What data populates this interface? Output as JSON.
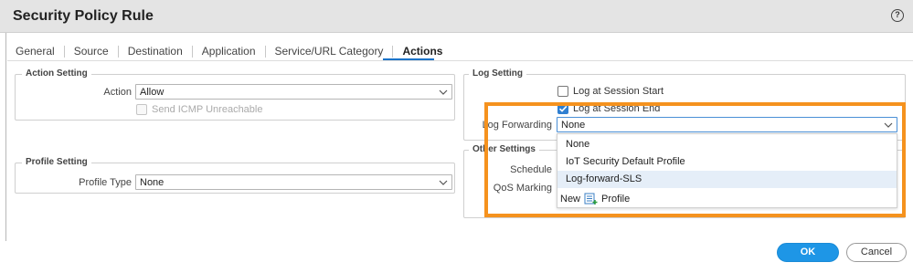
{
  "dialog": {
    "title": "Security Policy Rule",
    "help_glyph": "?"
  },
  "tabs": [
    {
      "label": "General"
    },
    {
      "label": "Source"
    },
    {
      "label": "Destination"
    },
    {
      "label": "Application"
    },
    {
      "label": "Service/URL Category"
    },
    {
      "label": "Actions"
    }
  ],
  "active_tab": "Actions",
  "action_setting": {
    "legend": "Action Setting",
    "action_label": "Action",
    "action_value": "Allow",
    "icmp_label": "Send ICMP Unreachable",
    "icmp_checked": false,
    "icmp_disabled": true
  },
  "profile_setting": {
    "legend": "Profile Setting",
    "profile_type_label": "Profile Type",
    "profile_type_value": "None"
  },
  "log_setting": {
    "legend": "Log Setting",
    "session_start_label": "Log at Session Start",
    "session_start_checked": false,
    "session_end_label": "Log at Session End",
    "session_end_checked": true,
    "forwarding_label": "Log Forwarding",
    "forwarding_value": "None"
  },
  "other_settings": {
    "legend": "Other Settings",
    "schedule_label": "Schedule",
    "qos_label": "QoS Marking"
  },
  "log_forwarding_dropdown": {
    "options": [
      "None",
      "IoT Security Default Profile",
      "Log-forward-SLS"
    ],
    "hovered_option": "Log-forward-SLS",
    "new_label": "New",
    "new_profile_label": "Profile"
  },
  "buttons": {
    "ok": "OK",
    "cancel": "Cancel"
  },
  "colors": {
    "accent": "#1e96e6",
    "tab_underline": "#1a73c9",
    "checkbox_checked": "#2f7fd1",
    "highlight_box": "#f5921e"
  },
  "icons": {
    "help": "question-circle-icon",
    "dropdown": "chevron-down-icon",
    "new_profile": "document-plus-icon"
  }
}
